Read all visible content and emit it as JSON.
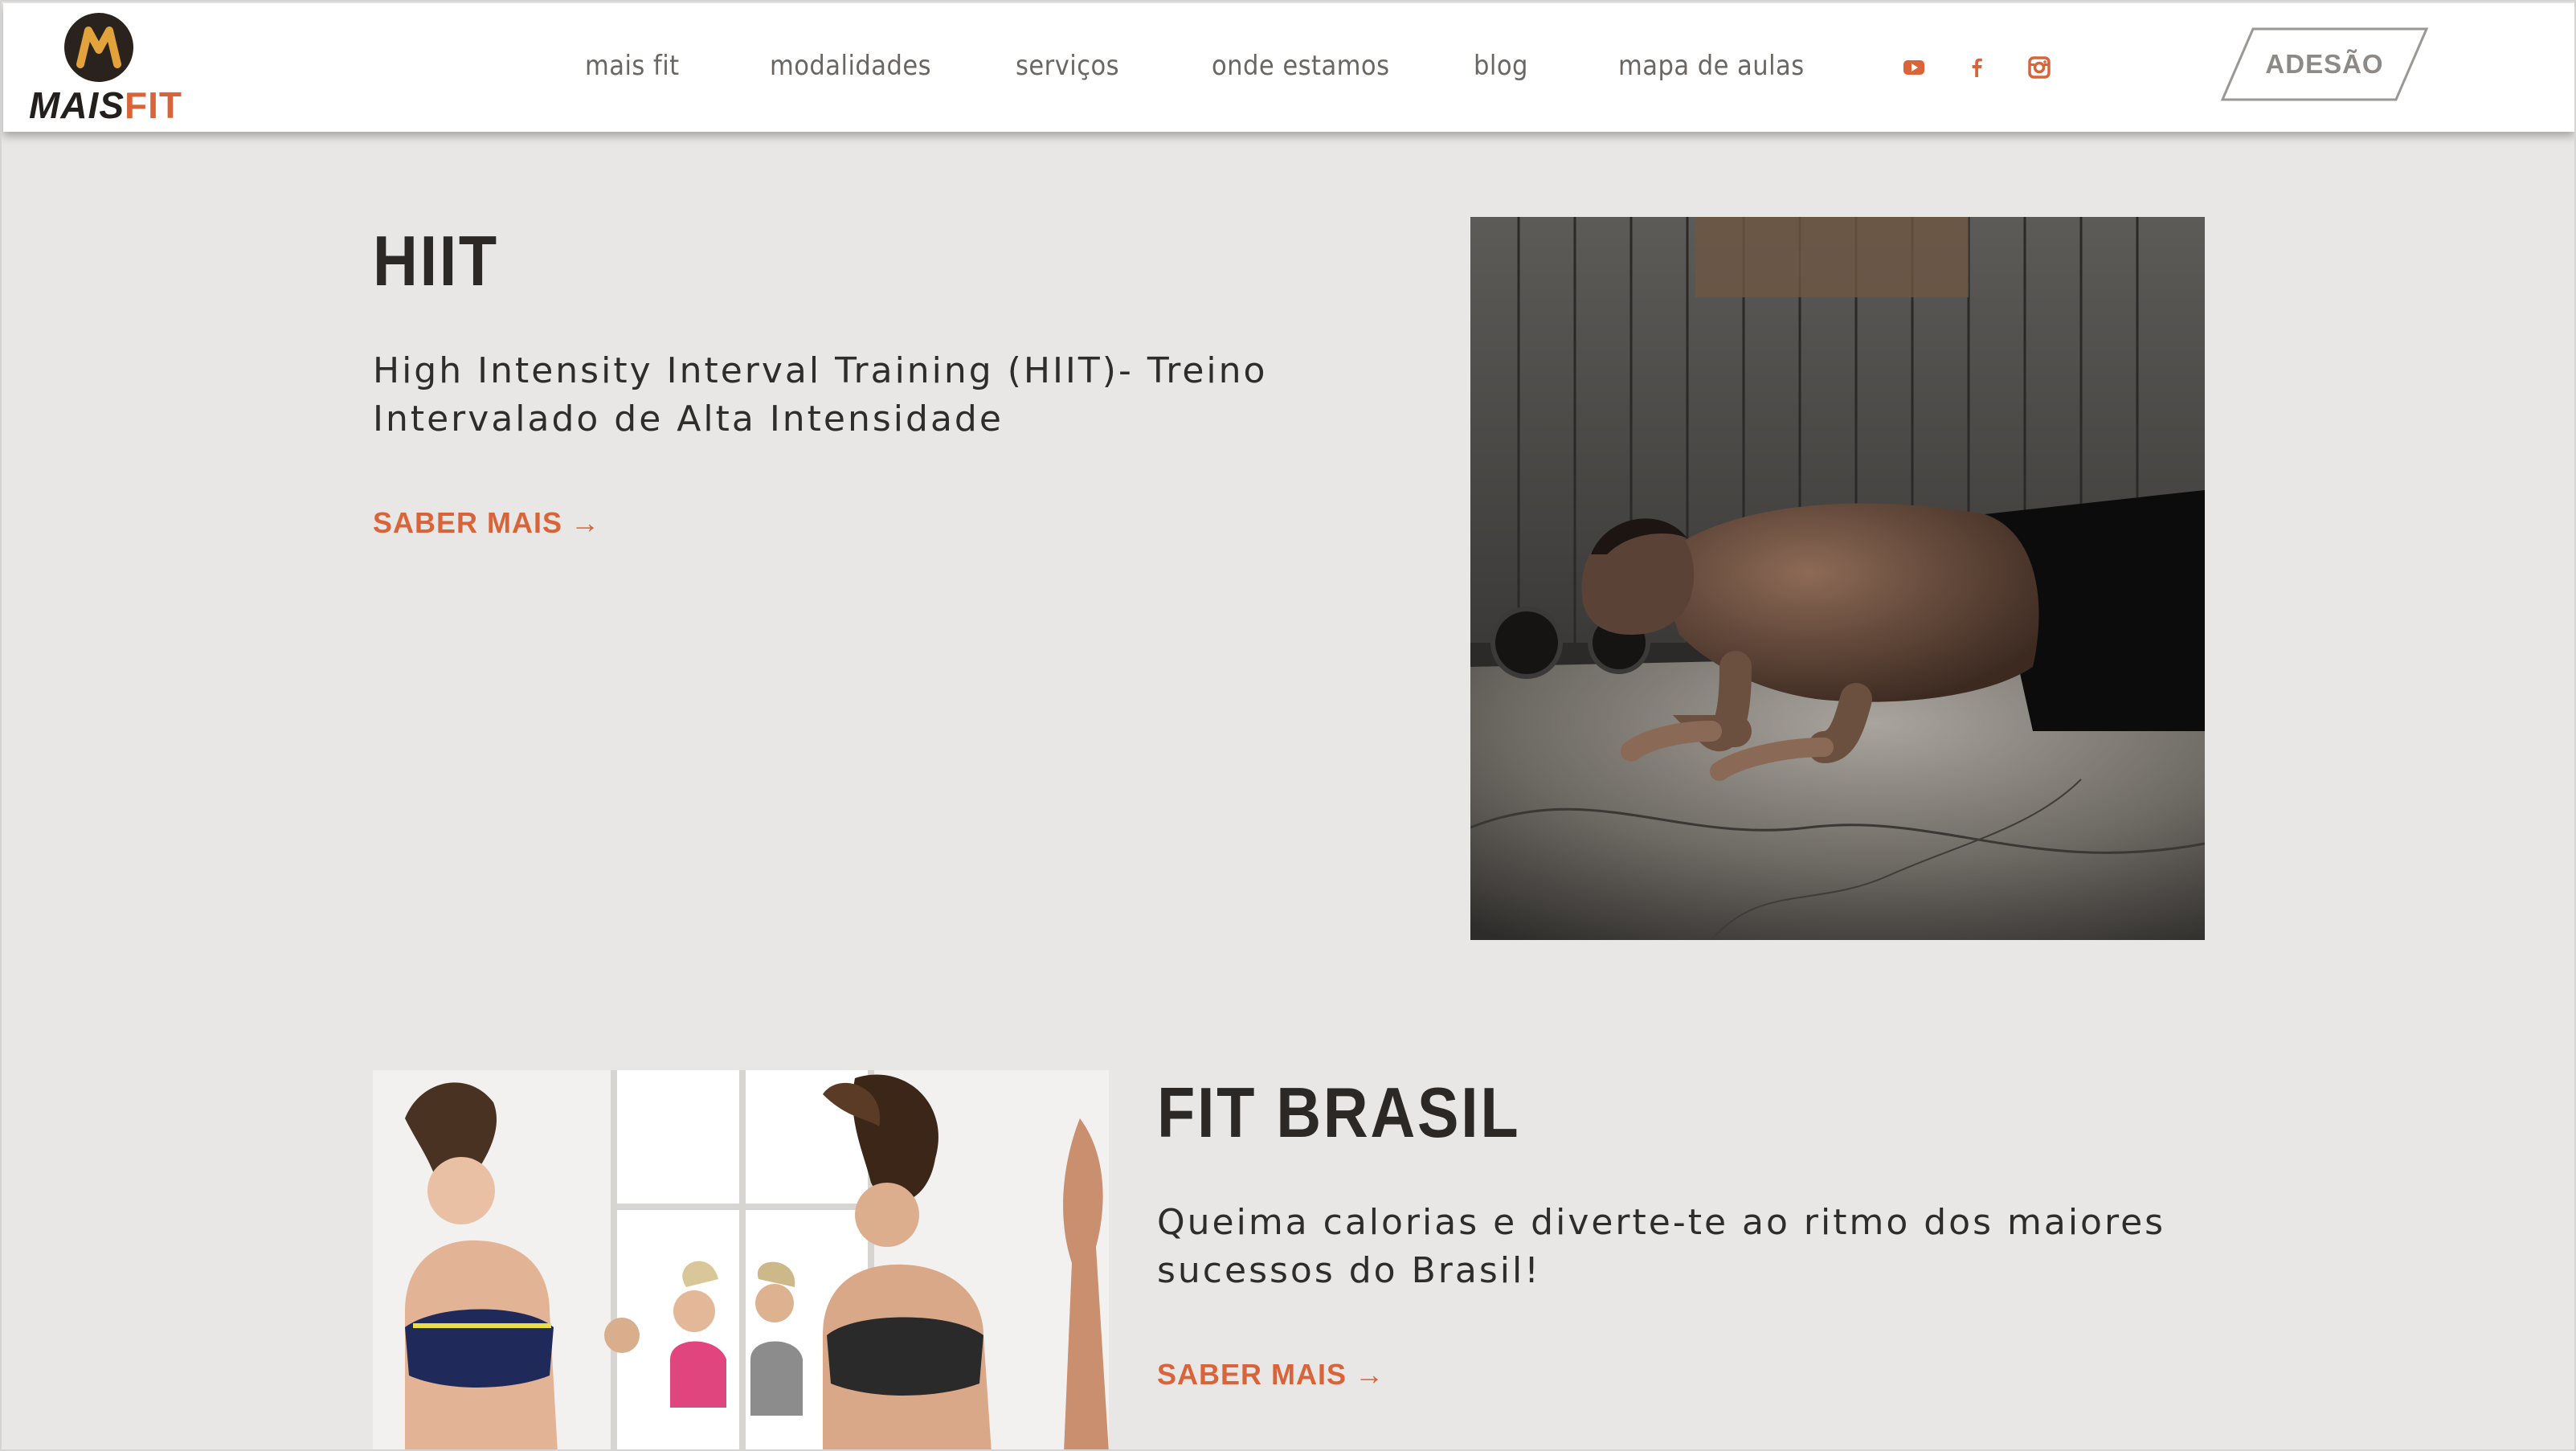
{
  "brand": {
    "logo_word_main": "MAIS",
    "logo_word_accent": "FIT",
    "logo_letter": "M",
    "accent_color": "#d9643a"
  },
  "nav": {
    "items": [
      {
        "label": "mais fit"
      },
      {
        "label": "modalidades"
      },
      {
        "label": "serviços"
      },
      {
        "label": "onde estamos"
      },
      {
        "label": "blog"
      },
      {
        "label": "mapa de aulas"
      }
    ],
    "social": [
      {
        "icon": "youtube-icon"
      },
      {
        "icon": "facebook-icon"
      },
      {
        "icon": "instagram-icon"
      }
    ],
    "cta_label": "ADESÃO"
  },
  "classes": [
    {
      "title": "HIIT",
      "description": "High Intensity Interval Training (HIIT)- Treino Intervalado de Alta Intensidade",
      "cta": "SABER MAIS",
      "arrow": "→",
      "image": "man-doing-push-up-photo"
    },
    {
      "title": "FIT BRASIL",
      "description": "Queima calorias e diverte-te ao ritmo dos maiores sucessos do Brasil!",
      "cta": "SABER MAIS",
      "arrow": "→",
      "image": "women-dancing-photo"
    }
  ]
}
